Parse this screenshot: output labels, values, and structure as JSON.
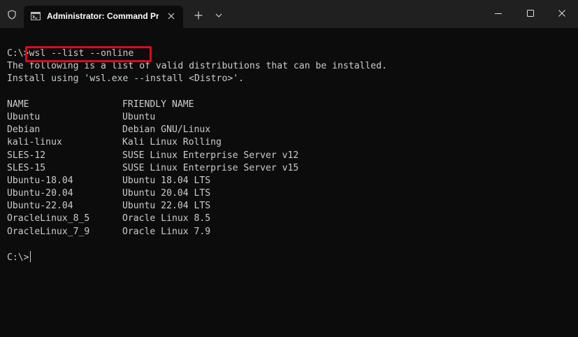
{
  "window": {
    "tab_title": "Administrator: Command Pro",
    "icons": {
      "shield": "shield-icon",
      "terminal": "command-prompt-icon",
      "close_tab": "close-icon",
      "new_tab": "plus-icon",
      "dropdown": "chevron-down-icon",
      "minimize": "minimize-icon",
      "maximize": "maximize-icon",
      "close": "close-icon"
    }
  },
  "terminal": {
    "prompt": "C:\\>",
    "command": "wsl --list --online",
    "info_lines": [
      "The following is a list of valid distributions that can be installed.",
      "Install using 'wsl.exe --install <Distro>'."
    ],
    "table_headers": [
      "NAME",
      "FRIENDLY NAME"
    ],
    "distributions": [
      {
        "name": "Ubuntu",
        "friendly": "Ubuntu"
      },
      {
        "name": "Debian",
        "friendly": "Debian GNU/Linux"
      },
      {
        "name": "kali-linux",
        "friendly": "Kali Linux Rolling"
      },
      {
        "name": "SLES-12",
        "friendly": "SUSE Linux Enterprise Server v12"
      },
      {
        "name": "SLES-15",
        "friendly": "SUSE Linux Enterprise Server v15"
      },
      {
        "name": "Ubuntu-18.04",
        "friendly": "Ubuntu 18.04 LTS"
      },
      {
        "name": "Ubuntu-20.04",
        "friendly": "Ubuntu 20.04 LTS"
      },
      {
        "name": "Ubuntu-22.04",
        "friendly": "Ubuntu 22.04 LTS"
      },
      {
        "name": "OracleLinux_8_5",
        "friendly": "Oracle Linux 8.5"
      },
      {
        "name": "OracleLinux_7_9",
        "friendly": "Oracle Linux 7.9"
      }
    ],
    "final_prompt": "C:\\>"
  },
  "colors": {
    "background": "#0c0c0c",
    "titlebar": "#202020",
    "text": "#cccccc",
    "highlight_border": "#d90b1c"
  }
}
